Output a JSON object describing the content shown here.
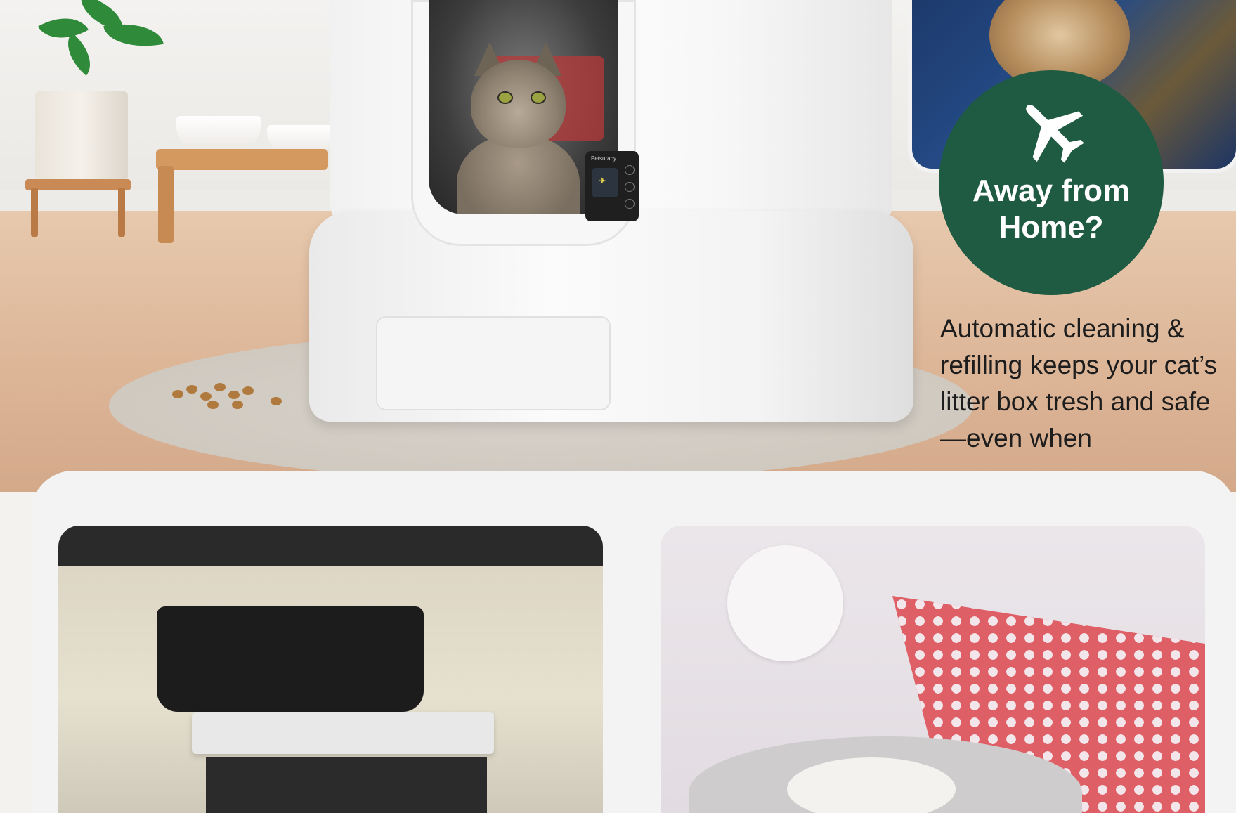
{
  "badge": {
    "icon": "airplane-icon",
    "title_line1": "Away from",
    "title_line2": "Home?",
    "color": "#1f5b43"
  },
  "description": {
    "text": "Automatic cleaning & refilling keeps your cat’s litter box tresh and safe—even when"
  },
  "product_panel": {
    "logo_text": "Petsuraby"
  }
}
